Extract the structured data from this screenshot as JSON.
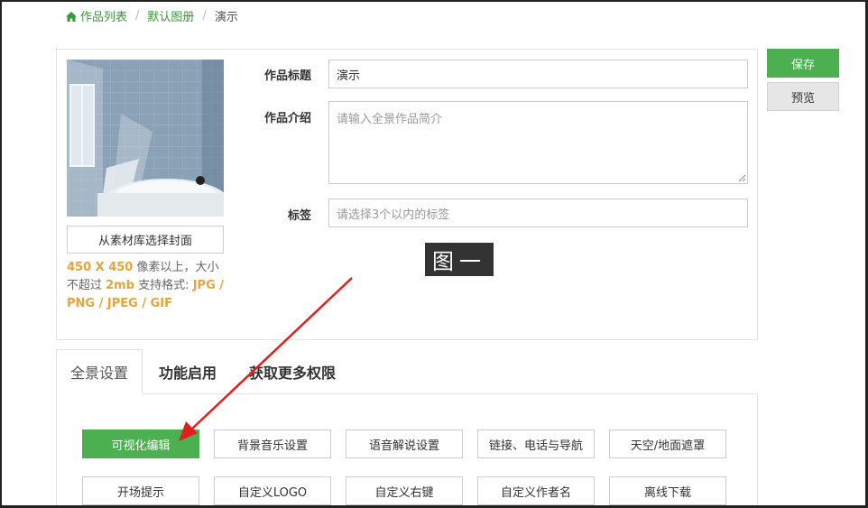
{
  "breadcrumb": {
    "items": [
      "作品列表",
      "默认图册",
      "演示"
    ],
    "separator": "/"
  },
  "cover": {
    "button_label": "从素材库选择封面",
    "hint_size": "450 X 450",
    "hint_text1": " 像素以上，大小不超过 ",
    "hint_maxsize": "2mb",
    "hint_text2": " 支持格式: ",
    "hint_formats": "JPG / PNG / JPEG / GIF"
  },
  "form": {
    "title_label": "作品标题",
    "title_value": "演示",
    "intro_label": "作品介绍",
    "intro_placeholder": "请输入全景作品简介",
    "tags_label": "标签",
    "tags_placeholder": "请选择3个以内的标签"
  },
  "watermark_text": "图一",
  "actions": {
    "save_label": "保存",
    "preview_label": "预览"
  },
  "tabs": [
    "全景设置",
    "功能启用",
    "获取更多权限"
  ],
  "function_buttons": [
    "可视化编辑",
    "背景音乐设置",
    "语音解说设置",
    "链接、电话与导航",
    "天空/地面遮罩",
    "开场提示",
    "自定义LOGO",
    "自定义右键",
    "自定义作者名",
    "离线下载"
  ],
  "colors": {
    "accent": "#4caf50",
    "link": "#3a9a3a",
    "hint_highlight": "#e8a33a",
    "annotation_arrow": "#e02020"
  },
  "icons": {
    "home": "home-icon"
  }
}
